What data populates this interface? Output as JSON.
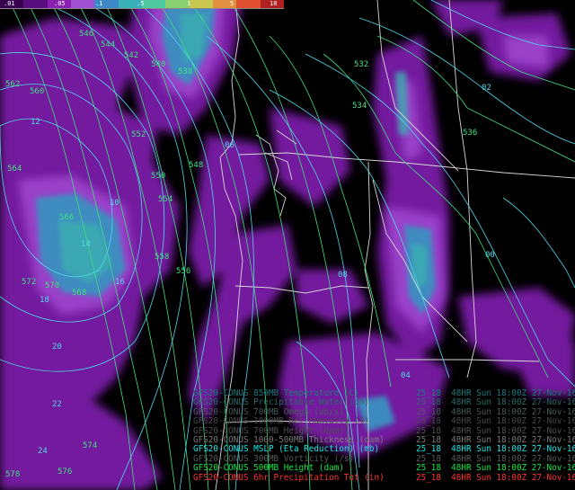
{
  "colorbar": {
    "ticks": [
      ".01",
      ".05",
      ".1",
      ".5",
      "1",
      "5",
      "10"
    ],
    "colors": [
      "#3a0050",
      "#5a0f80",
      "#8a1fb0",
      "#a050d0",
      "#3a88c8",
      "#3ab0b8",
      "#50c8a0",
      "#88d070",
      "#c8c850",
      "#e09040",
      "#e05030",
      "#b02020"
    ]
  },
  "legend": [
    {
      "desc": "GFS20-CONUS 850MB Temperature (C)",
      "time": "25_18  48HR Sun 18:00Z 27-Nov-16",
      "color": "#1a7a7a"
    },
    {
      "desc": "GFS20-CONUS Precipitable Water (in)",
      "time": "25_18  48HR Sun 18:00Z 27-Nov-16",
      "color": "#2a6a6a"
    },
    {
      "desc": "GFS20-CONUS 700MB Omega (ub/s)",
      "time": "25_18  48HR Sun 18:00Z 27-Nov-16",
      "color": "#4a5a5a"
    },
    {
      "desc": "GFS20-CONUS 1000MB Rel Humidity (%)",
      "time": "25_18  48HR Sun 18:00Z 27-Nov-16",
      "color": "#4a4a4a"
    },
    {
      "desc": "GFS20-CONUS 700MB Height (dam)",
      "time": "25_18  48HR Sun 18:00Z 27-Nov-16",
      "color": "#505050"
    },
    {
      "desc": "GFS20-CONUS 1000-500MB Thickness (dam)",
      "time": "25_18  48HR Sun 18:00Z 27-Nov-16",
      "color": "#7a7a7a"
    },
    {
      "desc": "GFS20-CONUS MSLP (Eta Reduction) (mb)",
      "time": "25_18  48HR Sun 18:00Z 27-Nov-16",
      "color": "#18e8e8"
    },
    {
      "desc": "GFS20-CONUS 300MB Vorticity (/s)",
      "time": "25_18  48HR Sun 18:00Z 27-Nov-16",
      "color": "#5a5a5a"
    },
    {
      "desc": "GFS20-CONUS 500MB Height (dam)",
      "time": "25_18  48HR Sun 18:00Z 27-Nov-16",
      "color": "#10e840"
    },
    {
      "desc": "GFS20-CONUS 6hr Precipitation Tot (in)",
      "time": "25_18  48HR Sun 18:00Z 27-Nov-16",
      "color": "#ff3030"
    }
  ],
  "height_labels": [
    "546",
    "544",
    "542",
    "540",
    "538",
    "536",
    "534",
    "532",
    "562",
    "560",
    "564",
    "552",
    "548",
    "550",
    "554",
    "556",
    "558",
    "566",
    "568",
    "570",
    "572",
    "574",
    "576",
    "578"
  ],
  "pressure_labels": [
    "12",
    "14",
    "16",
    "18",
    "20",
    "22",
    "24",
    "10",
    "08",
    "06",
    "04",
    "02",
    "00"
  ],
  "colors": {
    "height_contour": "#3fe07f",
    "pressure_contour": "#4fd8e8",
    "map_lines": "#d8d8d8",
    "background": "#000000"
  }
}
